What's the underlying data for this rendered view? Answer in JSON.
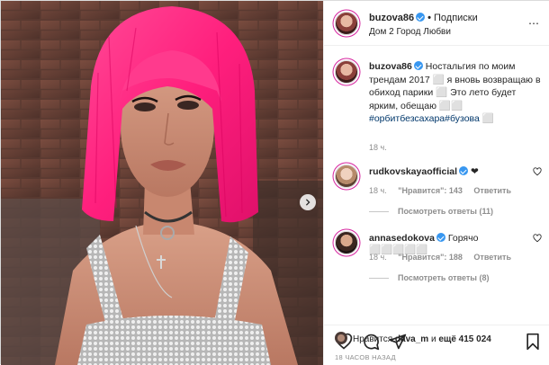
{
  "colors": {
    "accent": "#3897f0",
    "wig": "#ff1f7d",
    "text": "#262626",
    "muted": "#8e8e8e",
    "hashtag": "#00376b"
  },
  "header": {
    "username": "buzova86",
    "separator": "•",
    "follow_label": "Подписки",
    "location": "Дом 2 Город Любви",
    "more_icon": "⋯"
  },
  "caption": {
    "username": "buzova86",
    "text": "Ностальгия по моим трендам 2017 ⬜ я вновь возвращаю в обиход парики ⬜ Это лето будет ярким, обещаю ⬜⬜",
    "hashtags": "#орбитбезсахара#бузова ⬜",
    "time": "18 ч."
  },
  "comments": [
    {
      "username": "rudkovskayaofficial",
      "text": "❤",
      "time": "18 ч.",
      "likes": "\"Нравится\": 143",
      "reply_label": "Ответить",
      "replies": "Посмотреть ответы (11)"
    },
    {
      "username": "annasedokova",
      "text": "Горячо ⬜⬜⬜⬜⬜",
      "time": "18 ч.",
      "likes": "\"Нравится\": 188",
      "reply_label": "Ответить",
      "replies": "Посмотреть ответы (8)"
    }
  ],
  "actions": {
    "icons": [
      "heart-icon",
      "comment-icon",
      "share-icon",
      "bookmark-icon"
    ]
  },
  "likes": {
    "prefix": "Нравится",
    "user": "dava_m",
    "middle": "и",
    "count": "ещё 415 024"
  },
  "post_time": "18 ЧАСОВ НАЗАД"
}
